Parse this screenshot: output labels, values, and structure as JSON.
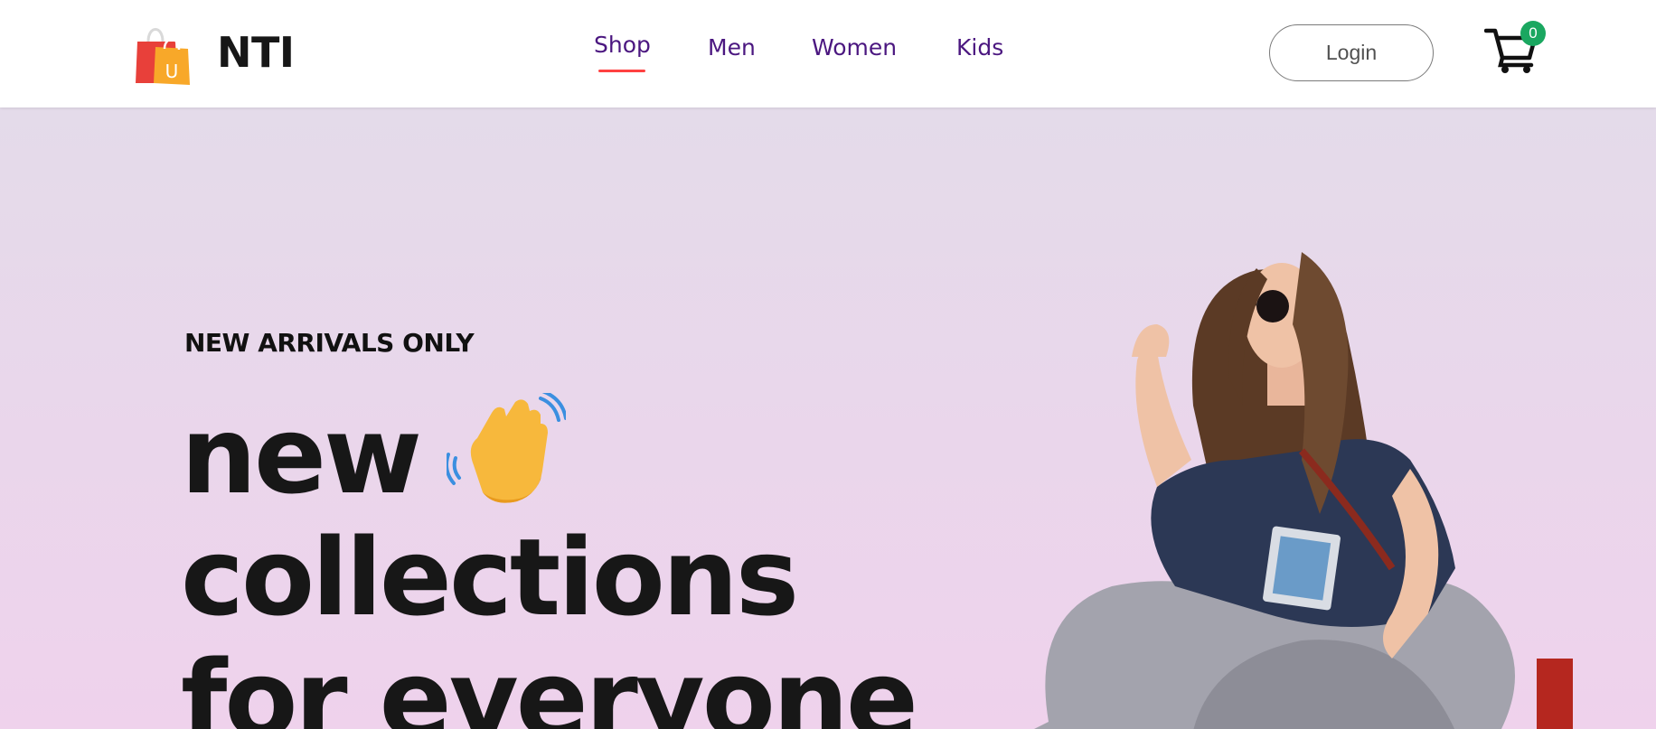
{
  "brand": {
    "name": "NTI",
    "bag_letter": "U"
  },
  "nav": {
    "links": [
      {
        "label": "Shop",
        "active": true
      },
      {
        "label": "Men",
        "active": false
      },
      {
        "label": "Women",
        "active": false
      },
      {
        "label": "Kids",
        "active": false
      }
    ]
  },
  "header": {
    "login_label": "Login",
    "cart_count": "0"
  },
  "hero": {
    "eyebrow": "NEW ARRIVALS ONLY",
    "line1": "new",
    "line2": "collections",
    "line3": "for everyone"
  },
  "colors": {
    "nav_text": "#4b1780",
    "active_underline": "#ff4141",
    "badge": "#1aa760",
    "hero_gradient_top": "#e4dbea",
    "hero_gradient_bottom": "#efd2ec"
  },
  "icons": [
    "shopping-bag-icon",
    "cart-icon",
    "waving-hand-icon"
  ]
}
